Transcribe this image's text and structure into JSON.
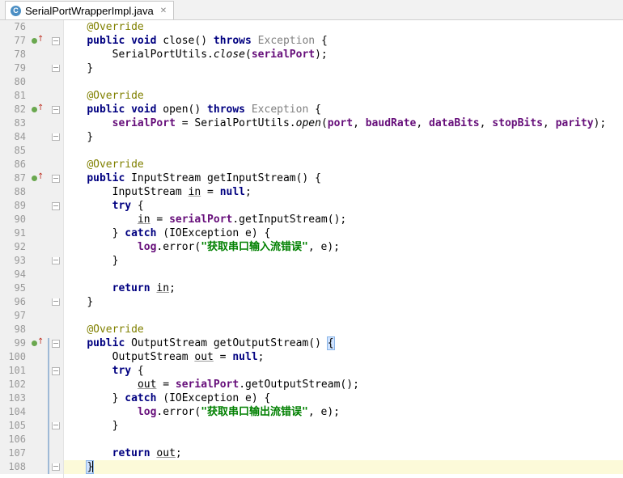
{
  "tab": {
    "title": "SerialPortWrapperImpl.java",
    "icon_letter": "C"
  },
  "colors": {
    "keyword": "#000080",
    "annotation": "#808000",
    "field": "#660e7a",
    "string": "#008000",
    "exception": "#808080",
    "current_line": "#fcfad9"
  },
  "lines": [
    {
      "n": "76",
      "t": [
        [
          "a",
          "@Override"
        ]
      ]
    },
    {
      "n": "77",
      "mark": true,
      "fold": "start",
      "t": [
        [
          "k",
          "public"
        ],
        [
          "",
          " "
        ],
        [
          "k",
          "void"
        ],
        [
          "",
          " close() "
        ],
        [
          "k",
          "throws"
        ],
        [
          "",
          " "
        ],
        [
          "g",
          "Exception"
        ],
        [
          "",
          " {"
        ]
      ]
    },
    {
      "n": "78",
      "t": [
        [
          "",
          "    SerialPortUtils."
        ],
        [
          "i",
          "close"
        ],
        [
          "",
          "("
        ],
        [
          "f",
          "serialPort"
        ],
        [
          "",
          ");"
        ]
      ]
    },
    {
      "n": "79",
      "fold": "end",
      "t": [
        [
          "",
          "}"
        ]
      ]
    },
    {
      "n": "80",
      "t": []
    },
    {
      "n": "81",
      "t": [
        [
          "a",
          "@Override"
        ]
      ]
    },
    {
      "n": "82",
      "mark": true,
      "fold": "start",
      "t": [
        [
          "k",
          "public"
        ],
        [
          "",
          " "
        ],
        [
          "k",
          "void"
        ],
        [
          "",
          " open() "
        ],
        [
          "k",
          "throws"
        ],
        [
          "",
          " "
        ],
        [
          "g",
          "Exception"
        ],
        [
          "",
          " {"
        ]
      ]
    },
    {
      "n": "83",
      "t": [
        [
          "",
          "    "
        ],
        [
          "f",
          "serialPort"
        ],
        [
          "",
          " = SerialPortUtils."
        ],
        [
          "i",
          "open"
        ],
        [
          "",
          "("
        ],
        [
          "f",
          "port"
        ],
        [
          "",
          ", "
        ],
        [
          "f",
          "baudRate"
        ],
        [
          "",
          ", "
        ],
        [
          "f",
          "dataBits"
        ],
        [
          "",
          ", "
        ],
        [
          "f",
          "stopBits"
        ],
        [
          "",
          ", "
        ],
        [
          "f",
          "parity"
        ],
        [
          "",
          ");"
        ]
      ]
    },
    {
      "n": "84",
      "fold": "end",
      "t": [
        [
          "",
          "}"
        ]
      ]
    },
    {
      "n": "85",
      "t": []
    },
    {
      "n": "86",
      "t": [
        [
          "a",
          "@Override"
        ]
      ]
    },
    {
      "n": "87",
      "mark": true,
      "fold": "start",
      "t": [
        [
          "k",
          "public"
        ],
        [
          "",
          " InputStream getInputStream() {"
        ]
      ]
    },
    {
      "n": "88",
      "t": [
        [
          "",
          "    InputStream "
        ],
        [
          "u",
          "in"
        ],
        [
          "",
          " = "
        ],
        [
          "k",
          "null"
        ],
        [
          "",
          ";"
        ]
      ]
    },
    {
      "n": "89",
      "fold": "start",
      "t": [
        [
          "",
          "    "
        ],
        [
          "k",
          "try"
        ],
        [
          "",
          " {"
        ]
      ]
    },
    {
      "n": "90",
      "t": [
        [
          "",
          "        "
        ],
        [
          "u",
          "in"
        ],
        [
          "",
          " = "
        ],
        [
          "f",
          "serialPort"
        ],
        [
          "",
          ".getInputStream();"
        ]
      ]
    },
    {
      "n": "91",
      "t": [
        [
          "",
          "    } "
        ],
        [
          "k",
          "catch"
        ],
        [
          "",
          " (IOException e) {"
        ]
      ]
    },
    {
      "n": "92",
      "t": [
        [
          "",
          "        "
        ],
        [
          "f",
          "log"
        ],
        [
          "",
          ".error("
        ],
        [
          "s",
          "\"获取串口输入流错误\""
        ],
        [
          "",
          ", e);"
        ]
      ]
    },
    {
      "n": "93",
      "fold": "end",
      "t": [
        [
          "",
          "    }"
        ]
      ]
    },
    {
      "n": "94",
      "t": []
    },
    {
      "n": "95",
      "t": [
        [
          "",
          "    "
        ],
        [
          "k",
          "return"
        ],
        [
          "",
          " "
        ],
        [
          "u",
          "in"
        ],
        [
          "",
          ";"
        ]
      ]
    },
    {
      "n": "96",
      "fold": "end",
      "t": [
        [
          "",
          "}"
        ]
      ]
    },
    {
      "n": "97",
      "t": []
    },
    {
      "n": "98",
      "t": [
        [
          "a",
          "@Override"
        ]
      ]
    },
    {
      "n": "99",
      "mark": true,
      "fold": "start",
      "t": [
        [
          "k",
          "public"
        ],
        [
          "",
          " OutputStream getOutputStream() "
        ],
        [
          "b",
          "{"
        ]
      ]
    },
    {
      "n": "100",
      "t": [
        [
          "",
          "    OutputStream "
        ],
        [
          "u",
          "out"
        ],
        [
          "",
          " = "
        ],
        [
          "k",
          "null"
        ],
        [
          "",
          ";"
        ]
      ]
    },
    {
      "n": "101",
      "fold": "start",
      "t": [
        [
          "",
          "    "
        ],
        [
          "k",
          "try"
        ],
        [
          "",
          " {"
        ]
      ]
    },
    {
      "n": "102",
      "t": [
        [
          "",
          "        "
        ],
        [
          "u",
          "out"
        ],
        [
          "",
          " = "
        ],
        [
          "f",
          "serialPort"
        ],
        [
          "",
          ".getOutputStream();"
        ]
      ]
    },
    {
      "n": "103",
      "t": [
        [
          "",
          "    } "
        ],
        [
          "k",
          "catch"
        ],
        [
          "",
          " (IOException e) {"
        ]
      ]
    },
    {
      "n": "104",
      "t": [
        [
          "",
          "        "
        ],
        [
          "f",
          "log"
        ],
        [
          "",
          ".error("
        ],
        [
          "s",
          "\"获取串口输出流错误\""
        ],
        [
          "",
          ", e);"
        ]
      ]
    },
    {
      "n": "105",
      "fold": "end",
      "t": [
        [
          "",
          "    }"
        ]
      ]
    },
    {
      "n": "106",
      "t": []
    },
    {
      "n": "107",
      "t": [
        [
          "",
          "    "
        ],
        [
          "k",
          "return"
        ],
        [
          "",
          " "
        ],
        [
          "u",
          "out"
        ],
        [
          "",
          ";"
        ]
      ]
    },
    {
      "n": "108",
      "current": true,
      "fold": "end",
      "t": [
        [
          "b",
          "}"
        ],
        [
          "c",
          ""
        ]
      ]
    }
  ]
}
